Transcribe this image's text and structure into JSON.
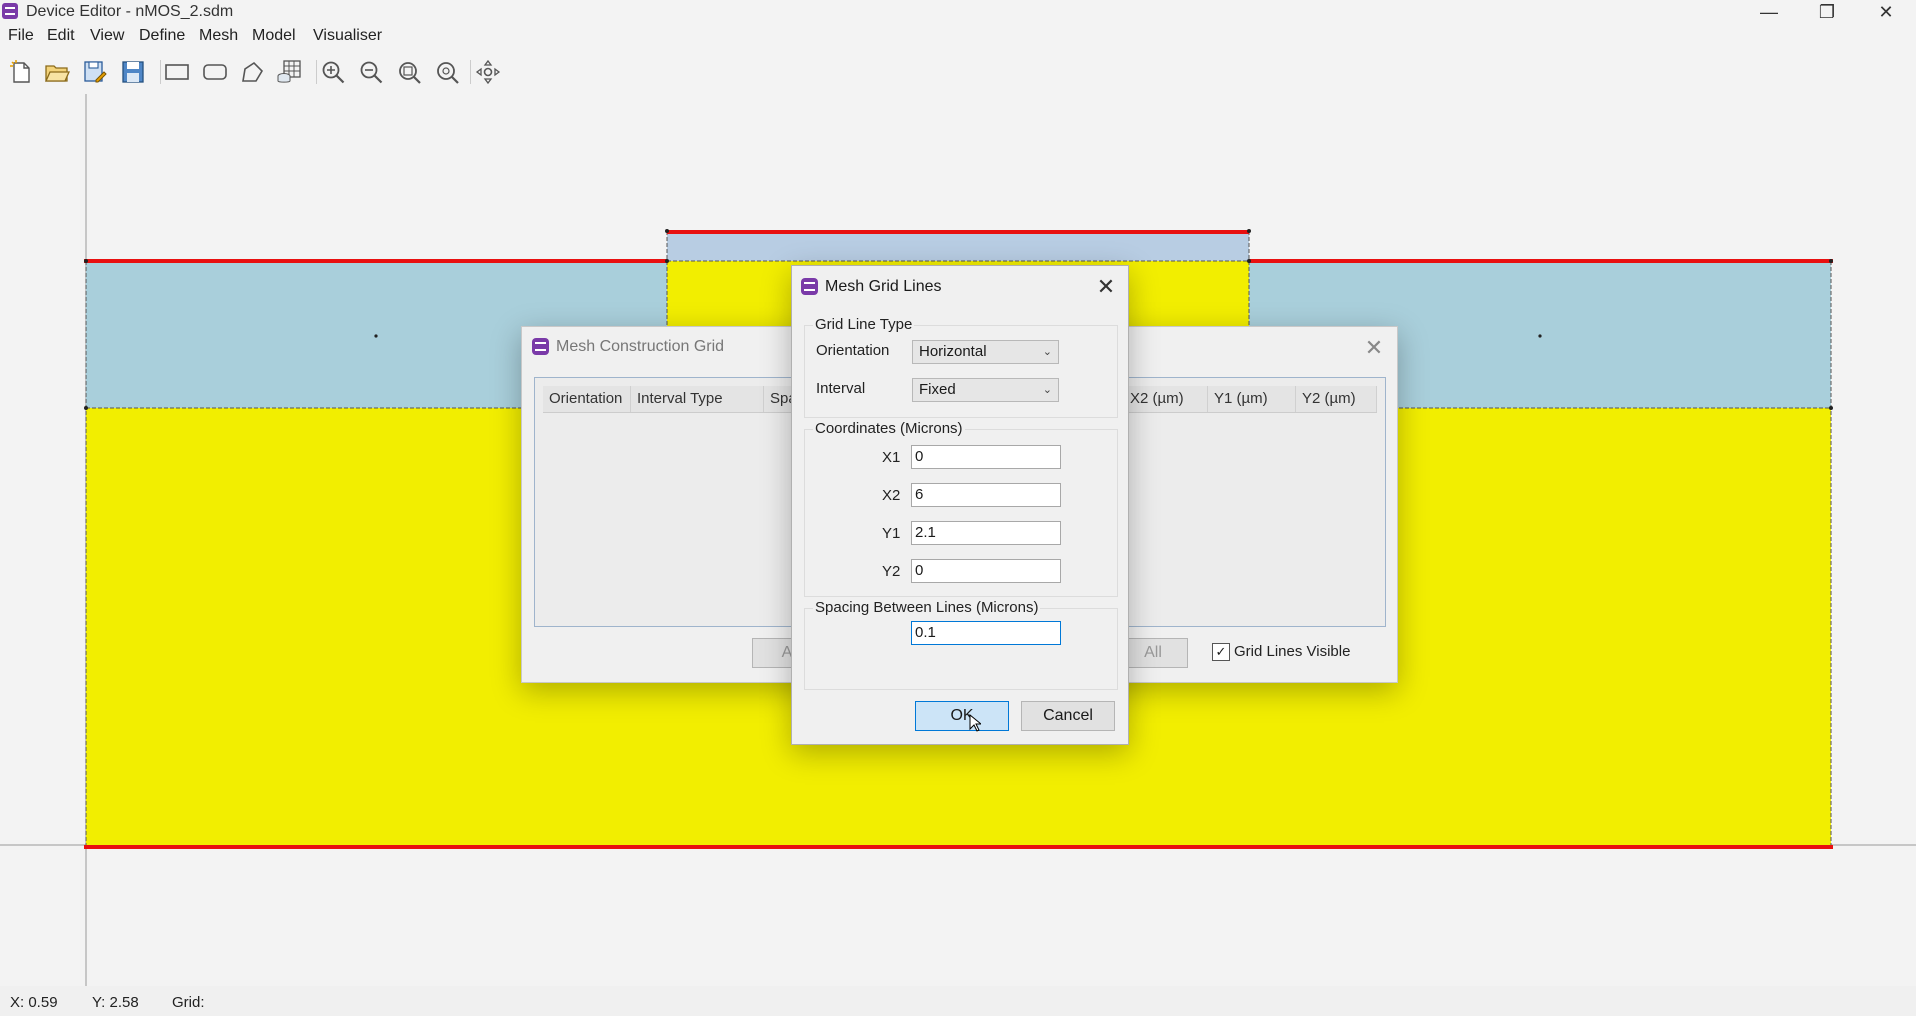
{
  "window": {
    "title": "Device Editor - nMOS_2.sdm",
    "minimize": "—",
    "maximize": "❐",
    "close": "✕"
  },
  "menu": [
    "File",
    "Edit",
    "View",
    "Define",
    "Mesh",
    "Model",
    "Visualiser"
  ],
  "toolbar_icons": [
    "new-icon",
    "open-icon",
    "save-as-icon",
    "save-icon",
    "rectangle-icon",
    "rounded-rectangle-icon",
    "polygon-icon",
    "mesh-grid-icon",
    "zoom-in-icon",
    "zoom-out-icon",
    "zoom-fit-icon",
    "zoom-reset-icon",
    "pan-icon"
  ],
  "colors": {
    "oxide": "#a9cfdb",
    "gate": "#b8cde3",
    "silicon": "#f2ee00",
    "contact": "#e81010",
    "accent": "#0078d7"
  },
  "mesh_construction_dialog": {
    "title": "Mesh Construction Grid",
    "close": "✕",
    "columns": [
      "Orientation",
      "Interval Type",
      "Spa",
      "X2 (µm)",
      "Y1 (µm)",
      "Y2 (µm)"
    ],
    "partial_button": "A",
    "all_button": "All",
    "grid_lines_visible_label": "Grid Lines Visible",
    "grid_lines_visible_checked": "✓"
  },
  "mesh_grid_lines_dialog": {
    "title": "Mesh Grid Lines",
    "close": "✕",
    "grid_line_type_label": "Grid Line Type",
    "orientation_label": "Orientation",
    "orientation_value": "Horizontal",
    "interval_label": "Interval",
    "interval_value": "Fixed",
    "coordinates_label": "Coordinates (Microns)",
    "x1_label": "X1",
    "x1_value": "0",
    "x2_label": "X2",
    "x2_value": "6",
    "y1_label": "Y1",
    "y1_value": "2.1",
    "y2_label": "Y2",
    "y2_value": "0",
    "spacing_label": "Spacing Between Lines (Microns)",
    "spacing_value": "0.1",
    "ok_label": "OK",
    "cancel_label": "Cancel"
  },
  "status": {
    "x": "X: 0.59",
    "y": "Y: 2.58",
    "grid": "Grid:"
  }
}
